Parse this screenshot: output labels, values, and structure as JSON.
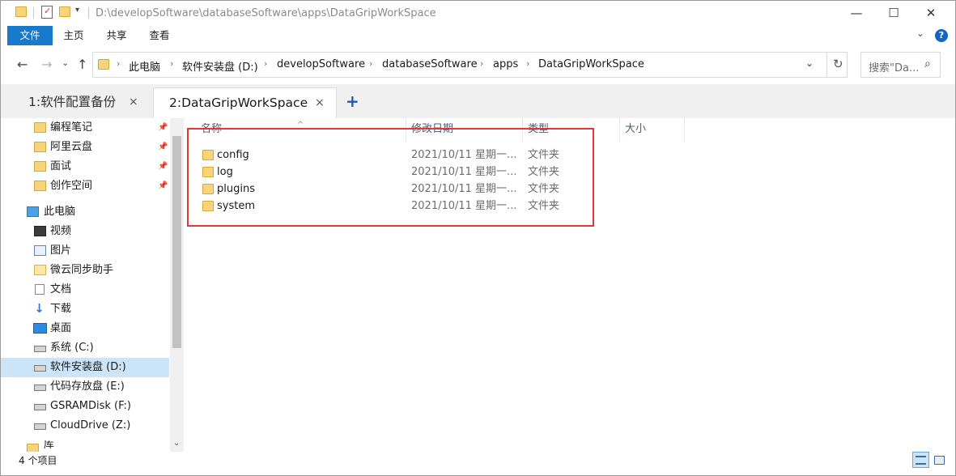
{
  "window": {
    "title": "D:\\developSoftware\\databaseSoftware\\apps\\DataGripWorkSpace",
    "minimize": "—",
    "maximize": "☐",
    "close": "✕"
  },
  "ribbon": {
    "tabs": [
      "文件",
      "主页",
      "共享",
      "查看"
    ],
    "help": "?",
    "expand": "⌄"
  },
  "nav": {
    "back": "←",
    "forward": "→",
    "recent": "⌄",
    "up": "↑",
    "breadcrumbs": [
      "此电脑",
      "软件安装盘 (D:)",
      "developSoftware",
      "databaseSoftware",
      "apps",
      "DataGripWorkSpace"
    ],
    "separator": "›",
    "dropdown": "⌄",
    "refresh": "↻",
    "search_placeholder": "搜索\"Da...",
    "search_icon": "⌕"
  },
  "tabs": {
    "items": [
      {
        "label": "1:软件配置备份",
        "active": false
      },
      {
        "label": "2:DataGripWorkSpace",
        "active": true
      }
    ],
    "close": "×",
    "add": "+"
  },
  "sidebar": {
    "pinned": [
      {
        "label": "编程笔记",
        "icon": "folder-icon"
      },
      {
        "label": "阿里云盘",
        "icon": "folder-icon"
      },
      {
        "label": "面试",
        "icon": "folder-icon"
      },
      {
        "label": "创作空间",
        "icon": "folder-icon"
      }
    ],
    "pin_glyph": "📌",
    "this_pc": "此电脑",
    "items": [
      {
        "label": "视频",
        "icon": "video-icon"
      },
      {
        "label": "图片",
        "icon": "picture-icon"
      },
      {
        "label": "微云同步助手",
        "icon": "cloud-folder-icon"
      },
      {
        "label": "文档",
        "icon": "document-icon"
      },
      {
        "label": "下载",
        "icon": "download-icon"
      },
      {
        "label": "桌面",
        "icon": "desktop-icon"
      },
      {
        "label": "系统 (C:)",
        "icon": "drive-icon"
      },
      {
        "label": "软件安装盘 (D:)",
        "icon": "drive-icon",
        "selected": true
      },
      {
        "label": "代码存放盘 (E:)",
        "icon": "drive-icon"
      },
      {
        "label": "GSRAMDisk (F:)",
        "icon": "drive-icon"
      },
      {
        "label": "CloudDrive (Z:)",
        "icon": "drive-icon"
      },
      {
        "label": "库",
        "icon": "folder-icon"
      }
    ],
    "scroll_down": "⌄"
  },
  "columns": {
    "name": "名称",
    "modified": "修改日期",
    "type": "类型",
    "size": "大小",
    "sort_indicator": "^"
  },
  "files": [
    {
      "name": "config",
      "modified": "2021/10/11 星期一...",
      "type": "文件夹"
    },
    {
      "name": "log",
      "modified": "2021/10/11 星期一...",
      "type": "文件夹"
    },
    {
      "name": "plugins",
      "modified": "2021/10/11 星期一...",
      "type": "文件夹"
    },
    {
      "name": "system",
      "modified": "2021/10/11 星期一...",
      "type": "文件夹"
    }
  ],
  "status": {
    "item_count": "4 个项目"
  },
  "colors": {
    "accent": "#1979ca",
    "selection": "#cce4f7",
    "highlight_box": "#e53535"
  }
}
